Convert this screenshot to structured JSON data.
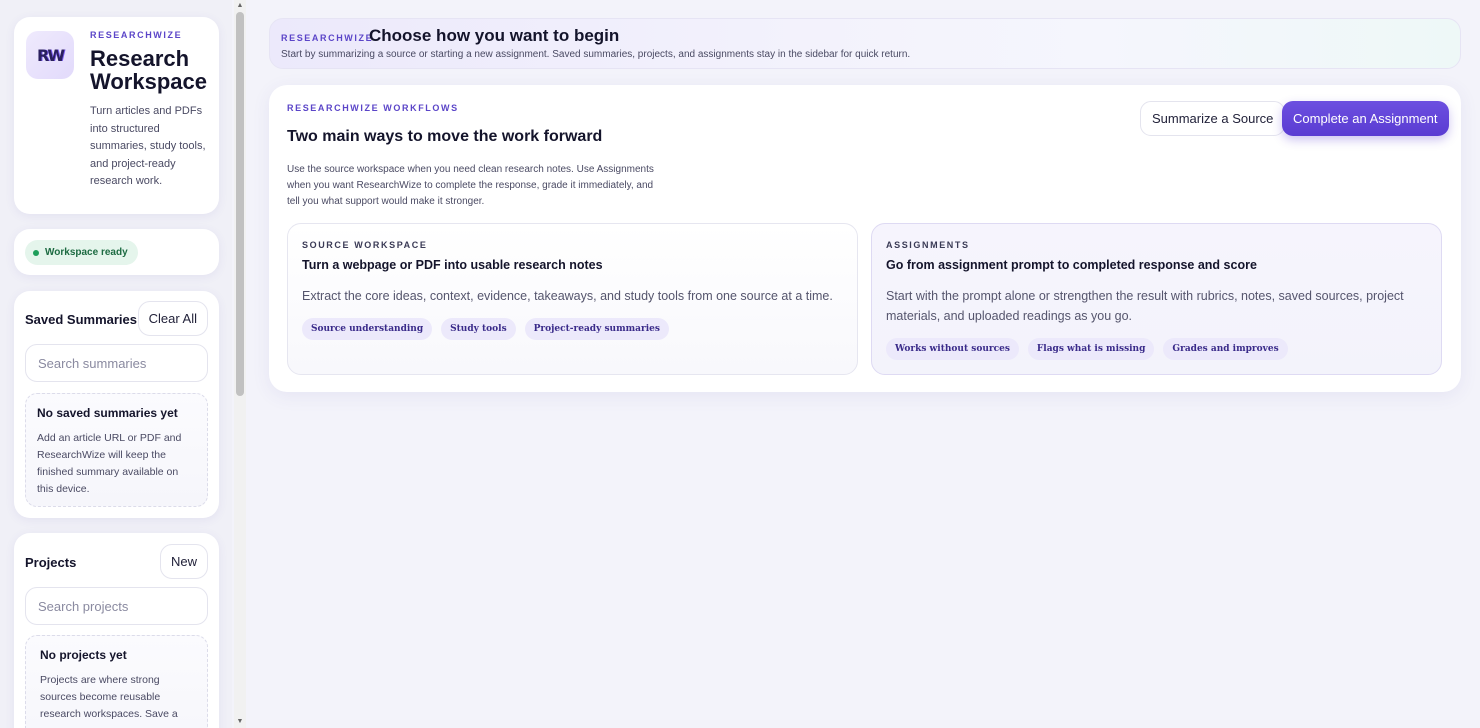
{
  "sidebar": {
    "brand": {
      "logo_text": "RW",
      "eyebrow": "RESEARCHWIZE",
      "title": "Research Workspace",
      "description": "Turn articles and PDFs into structured summaries, study tools, and project-ready research work."
    },
    "status": {
      "label": "Workspace ready",
      "color": "#1e9e5a"
    },
    "summaries": {
      "title": "Saved Summaries",
      "action_label": "Clear All",
      "search_placeholder": "Search summaries",
      "empty_title": "No saved summaries yet",
      "empty_desc": "Add an article URL or PDF and ResearchWize will keep the finished summary available on this device."
    },
    "projects": {
      "title": "Projects",
      "action_label": "New",
      "search_placeholder": "Search projects",
      "empty_title": "No projects yet",
      "empty_desc": "Projects are where strong sources become reusable research workspaces. Save a"
    }
  },
  "banner": {
    "eyebrow": "RESEARCHWIZE",
    "title": "Choose how you want to begin",
    "subtitle": "Start by summarizing a source or starting a new assignment. Saved summaries, projects, and assignments stay in the sidebar for quick return."
  },
  "workflows": {
    "eyebrow": "RESEARCHWIZE WORKFLOWS",
    "title": "Two main ways to move the work forward",
    "description": "Use the source workspace when you need clean research notes. Use Assignments when you want ResearchWize to complete the response, grade it immediately, and tell you what support would make it stronger.",
    "secondary_button": "Summarize a Source",
    "primary_button": "Complete an Assignment",
    "cards": [
      {
        "eyebrow": "SOURCE WORKSPACE",
        "title": "Turn a webpage or PDF into usable research notes",
        "description": "Extract the core ideas, context, evidence, takeaways, and study tools from one source at a time.",
        "tags": [
          "Source understanding",
          "Study tools",
          "Project-ready summaries"
        ]
      },
      {
        "eyebrow": "ASSIGNMENTS",
        "title": "Go from assignment prompt to completed response and score",
        "description": "Start with the prompt alone or strengthen the result with rubrics, notes, saved sources, project materials, and uploaded readings as you go.",
        "tags": [
          "Works without sources",
          "Flags what is missing",
          "Grades and improves"
        ]
      }
    ]
  },
  "colors": {
    "accent": "#5b45c8",
    "primary_button": "#6c4fe0",
    "status_green": "#1e9e5a"
  }
}
